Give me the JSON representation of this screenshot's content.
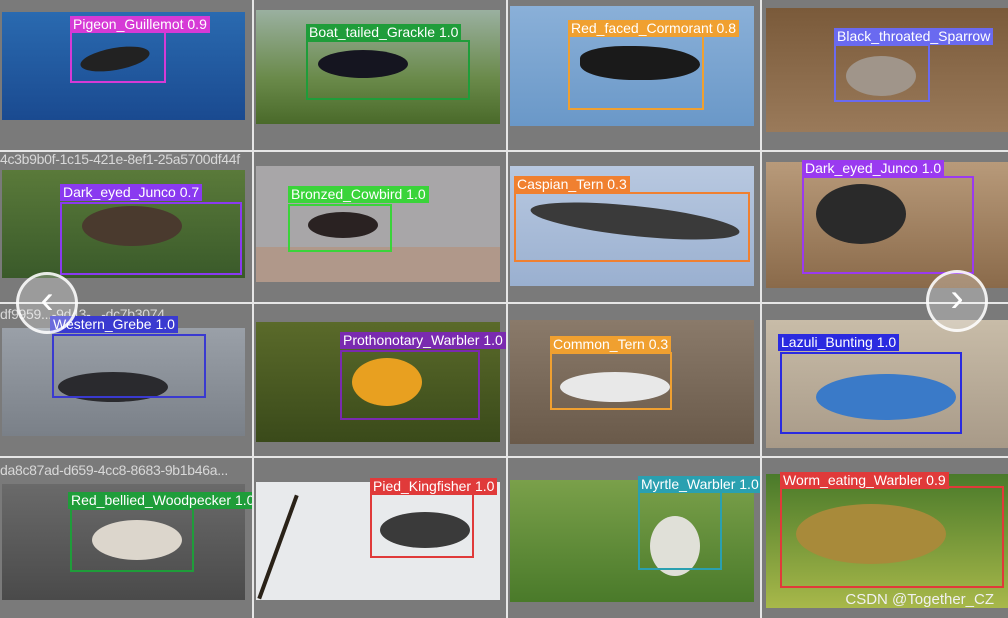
{
  "gallery": {
    "cells": [
      {
        "file": "f73be162-9323-4854-879c-5972...jpg",
        "label": "Pigeon_Guillemot 0.9",
        "color": "#d63ad6",
        "img": "water"
      },
      {
        "file": "2a1...jpg-c536-4a22-863e-fc5bb2a6e5c9.jpg",
        "label": "Boat_tailed_Grackle 1.0",
        "color": "#1f9d3a",
        "img": "grass"
      },
      {
        "file": "...jpg6aa-490d-bc4b-e770e6...",
        "label": "Red_faced_Cormorant 0.8",
        "color": "#f0a030",
        "img": "sky"
      },
      {
        "file": "...2d3a-40f6-8bf0-58...",
        "label": "Black_throated_Sparrow",
        "color": "#6a6af0",
        "img": "sand"
      },
      {
        "file": "4c3b9b0f-1c15-421e-8ef1-25a5700df44f",
        "label": "Dark_eyed_Junco 0.7",
        "color": "#8a3af0",
        "img": "grass2"
      },
      {
        "file": "...2f92-8975-4095-b459-9d43920824...",
        "label": "Bronzed_Cowbird 1.0",
        "color": "#3ad43a",
        "img": "rock"
      },
      {
        "file": "...24c3d-5b4c-44b9-ade7-e7bb8c5b...",
        "label": "Caspian_Tern 0.3",
        "color": "#f08030",
        "img": "lightsky"
      },
      {
        "file": "...d1-b159-426f-a486-286a24...",
        "label": "Dark_eyed_Junco 1.0",
        "color": "#9a3af0",
        "img": "wood"
      },
      {
        "file": "df9959...-9d43-...-dc7b3074...",
        "label": "Western_Grebe 1.0",
        "color": "#3a3ad0",
        "img": "grey"
      },
      {
        "file": "...2035.jpg-98c7-4296-b38e-21fd6645a...",
        "label": "Prothonotary_Warbler 1.0",
        "color": "#7a2ab0",
        "img": "moss"
      },
      {
        "file": "...5824.jpg-4ee8-4b42-9aaf-09c2a9...",
        "label": "Common_Tern 0.3",
        "color": "#f0a030",
        "img": "brown"
      },
      {
        "file": "...6a7d...ce26-4bb6-a152-8ec55...",
        "label": "Lazuli_Bunting 1.0",
        "color": "#2a2ae0",
        "img": "gravel"
      },
      {
        "file": "da8c87ad-d659-4cc8-8683-9b1b46a...",
        "label": "Red_bellied_Woodpecker 1.0",
        "color": "#1f9d3a",
        "img": "pebbles"
      },
      {
        "file": "...9de7-4560-8a3a-31b37...",
        "label": "Pied_Kingfisher 1.0",
        "color": "#e03a3a",
        "img": "white"
      },
      {
        "file": "...f1b9d1a-4b51-b160-cf8d775...",
        "label": "Myrtle_Warbler 1.0",
        "color": "#2aa0b0",
        "img": "green"
      },
      {
        "file": "...f1-49f4-9b19-a0...",
        "label": "Worm_eating_Warbler 0.9",
        "color": "#e03a3a",
        "img": "leaf"
      }
    ]
  },
  "nav": {
    "prev_glyph": "‹",
    "next_glyph": "›"
  },
  "watermark": "CSDN @Together_CZ"
}
